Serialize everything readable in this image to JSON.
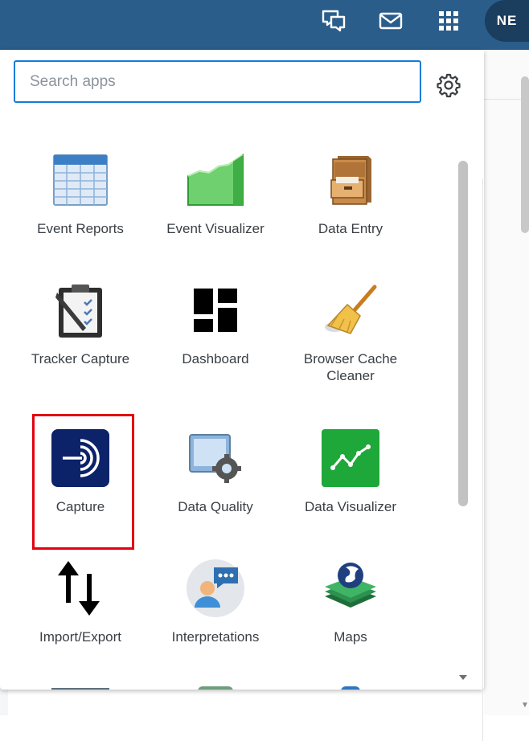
{
  "header": {
    "bg_color": "#2a5d8a",
    "icons": [
      "interpretations-icon",
      "messages-icon",
      "apps-icon"
    ],
    "avatar_initials": "NE"
  },
  "menu": {
    "search_placeholder": "Search apps",
    "settings_icon": "gear-icon",
    "apps": [
      {
        "label": "Event Reports",
        "icon": "spreadsheet-icon"
      },
      {
        "label": "Event Visualizer",
        "icon": "area-chart-icon"
      },
      {
        "label": "Data Entry",
        "icon": "file-cabinet-icon"
      },
      {
        "label": "Tracker Capture",
        "icon": "clipboard-icon"
      },
      {
        "label": "Dashboard",
        "icon": "dashboard-icon"
      },
      {
        "label": "Browser Cache\nCleaner",
        "icon": "broom-icon"
      },
      {
        "label": "Capture",
        "icon": "capture-icon"
      },
      {
        "label": "Data Quality",
        "icon": "data-quality-icon"
      },
      {
        "label": "Data Visualizer",
        "icon": "line-chart-icon"
      },
      {
        "label": "Import/Export",
        "icon": "import-export-icon"
      },
      {
        "label": "Interpretations",
        "icon": "interpretations-app-icon"
      },
      {
        "label": "Maps",
        "icon": "maps-icon"
      }
    ],
    "highlight_color": "#e3000f",
    "highlighted_app": "Capture"
  }
}
